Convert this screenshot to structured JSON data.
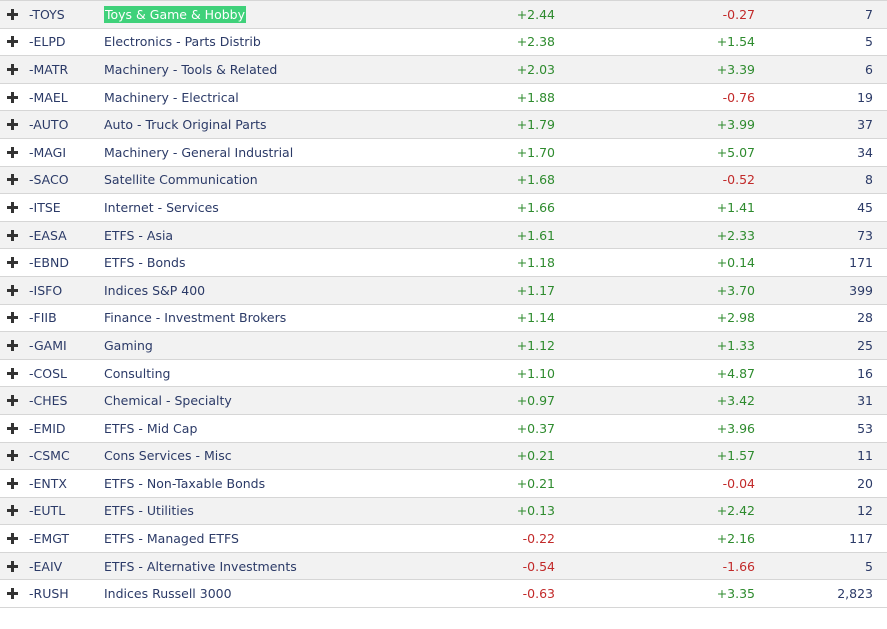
{
  "colors": {
    "positive": "#2e8b2e",
    "negative": "#c22a2a",
    "highlight": "#3fd17a",
    "text": "#2b3a67"
  },
  "icons": {
    "expand": "plus-icon"
  },
  "rows": [
    {
      "symbol": "-TOYS",
      "name": "Toys & Game & Hobby",
      "change1": "+2.44",
      "change2": "-0.27",
      "count": "7",
      "highlight": true
    },
    {
      "symbol": "-ELPD",
      "name": "Electronics - Parts Distrib",
      "change1": "+2.38",
      "change2": "+1.54",
      "count": "5"
    },
    {
      "symbol": "-MATR",
      "name": "Machinery - Tools & Related",
      "change1": "+2.03",
      "change2": "+3.39",
      "count": "6"
    },
    {
      "symbol": "-MAEL",
      "name": "Machinery - Electrical",
      "change1": "+1.88",
      "change2": "-0.76",
      "count": "19"
    },
    {
      "symbol": "-AUTO",
      "name": "Auto - Truck Original Parts",
      "change1": "+1.79",
      "change2": "+3.99",
      "count": "37"
    },
    {
      "symbol": "-MAGI",
      "name": "Machinery - General Industrial",
      "change1": "+1.70",
      "change2": "+5.07",
      "count": "34"
    },
    {
      "symbol": "-SACO",
      "name": "Satellite Communication",
      "change1": "+1.68",
      "change2": "-0.52",
      "count": "8"
    },
    {
      "symbol": "-ITSE",
      "name": "Internet - Services",
      "change1": "+1.66",
      "change2": "+1.41",
      "count": "45"
    },
    {
      "symbol": "-EASA",
      "name": "ETFS - Asia",
      "change1": "+1.61",
      "change2": "+2.33",
      "count": "73"
    },
    {
      "symbol": "-EBND",
      "name": "ETFS - Bonds",
      "change1": "+1.18",
      "change2": "+0.14",
      "count": "171"
    },
    {
      "symbol": "-ISFO",
      "name": "Indices S&P 400",
      "change1": "+1.17",
      "change2": "+3.70",
      "count": "399"
    },
    {
      "symbol": "-FIIB",
      "name": "Finance - Investment Brokers",
      "change1": "+1.14",
      "change2": "+2.98",
      "count": "28"
    },
    {
      "symbol": "-GAMI",
      "name": "Gaming",
      "change1": "+1.12",
      "change2": "+1.33",
      "count": "25"
    },
    {
      "symbol": "-COSL",
      "name": "Consulting",
      "change1": "+1.10",
      "change2": "+4.87",
      "count": "16"
    },
    {
      "symbol": "-CHES",
      "name": "Chemical - Specialty",
      "change1": "+0.97",
      "change2": "+3.42",
      "count": "31"
    },
    {
      "symbol": "-EMID",
      "name": "ETFS - Mid Cap",
      "change1": "+0.37",
      "change2": "+3.96",
      "count": "53"
    },
    {
      "symbol": "-CSMC",
      "name": "Cons Services - Misc",
      "change1": "+0.21",
      "change2": "+1.57",
      "count": "11"
    },
    {
      "symbol": "-ENTX",
      "name": "ETFS - Non-Taxable Bonds",
      "change1": "+0.21",
      "change2": "-0.04",
      "count": "20"
    },
    {
      "symbol": "-EUTL",
      "name": "ETFS - Utilities",
      "change1": "+0.13",
      "change2": "+2.42",
      "count": "12"
    },
    {
      "symbol": "-EMGT",
      "name": "ETFS - Managed ETFS",
      "change1": "-0.22",
      "change2": "+2.16",
      "count": "117"
    },
    {
      "symbol": "-EAIV",
      "name": "ETFS - Alternative Investments",
      "change1": "-0.54",
      "change2": "-1.66",
      "count": "5"
    },
    {
      "symbol": "-RUSH",
      "name": "Indices Russell 3000",
      "change1": "-0.63",
      "change2": "+3.35",
      "count": "2,823"
    }
  ]
}
